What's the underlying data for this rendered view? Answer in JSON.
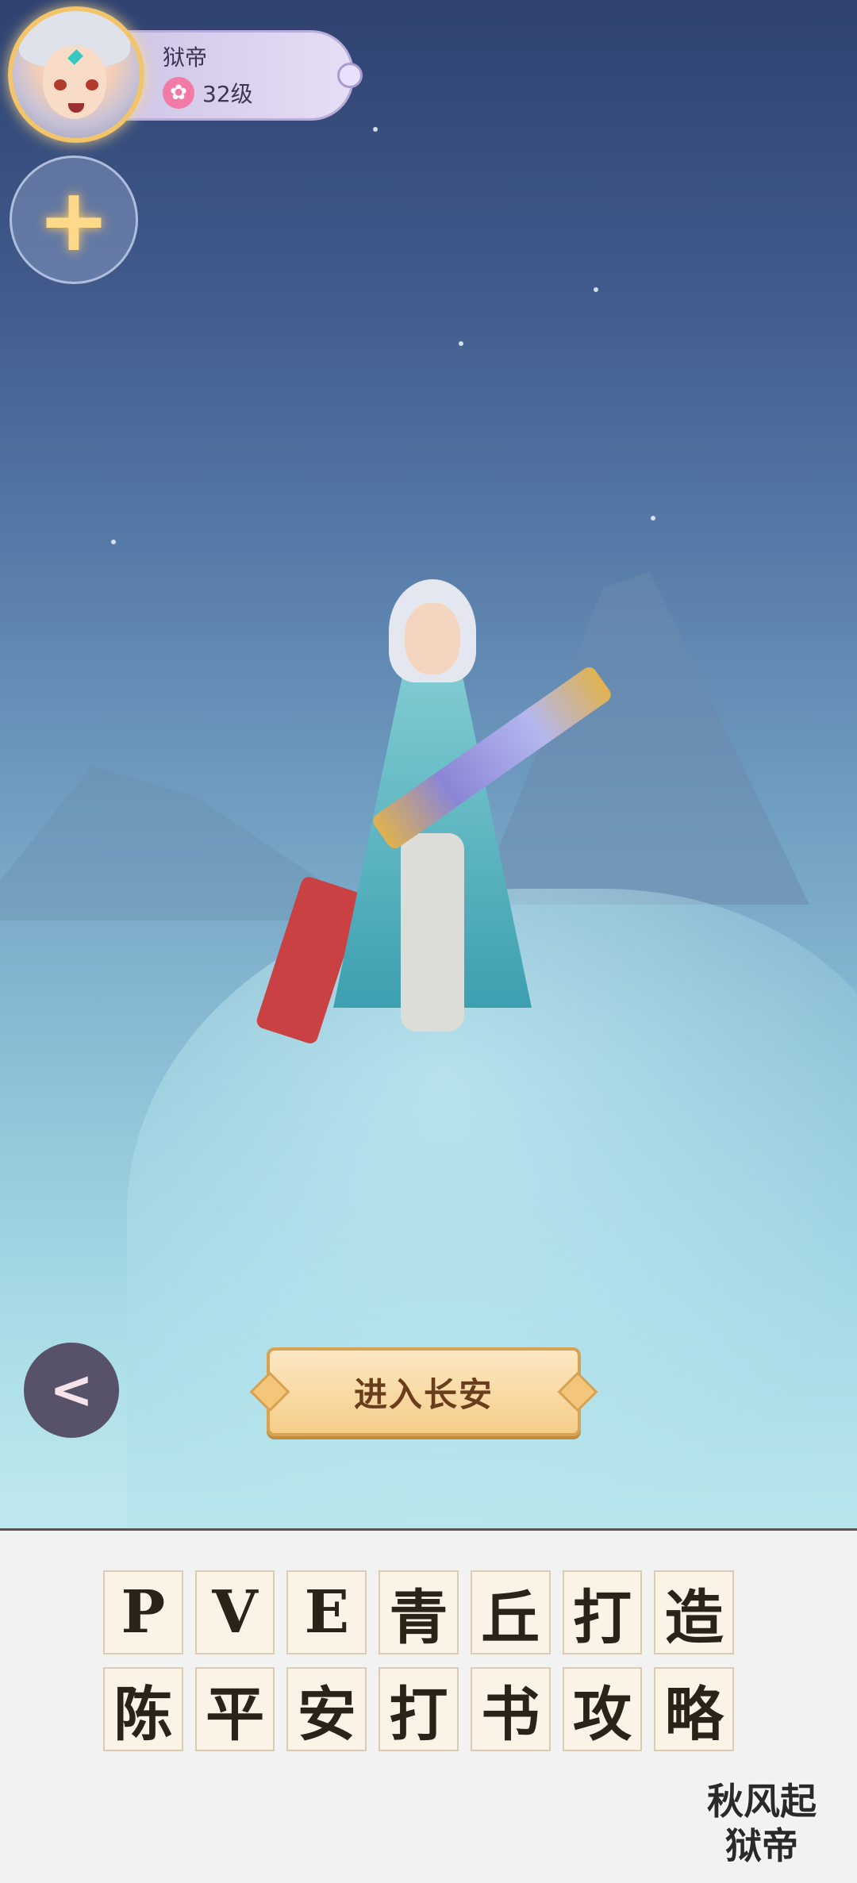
{
  "player": {
    "name": "狱帝",
    "level": "32级",
    "level_icon": "flower-icon"
  },
  "actions": {
    "add_icon": "+",
    "back_icon": "<",
    "enter_label": "进入长安"
  },
  "title_tiles": {
    "row1": [
      "P",
      "V",
      "E",
      "青",
      "丘",
      "打",
      "造"
    ],
    "row2": [
      "陈",
      "平",
      "安",
      "打",
      "书",
      "攻",
      "略"
    ]
  },
  "credit": {
    "line1": "秋风起",
    "line2": "狱帝"
  },
  "colors": {
    "button_gold": "#f5cd8a",
    "sky_top": "#2f4270",
    "sky_bottom": "#bfe9ee"
  }
}
